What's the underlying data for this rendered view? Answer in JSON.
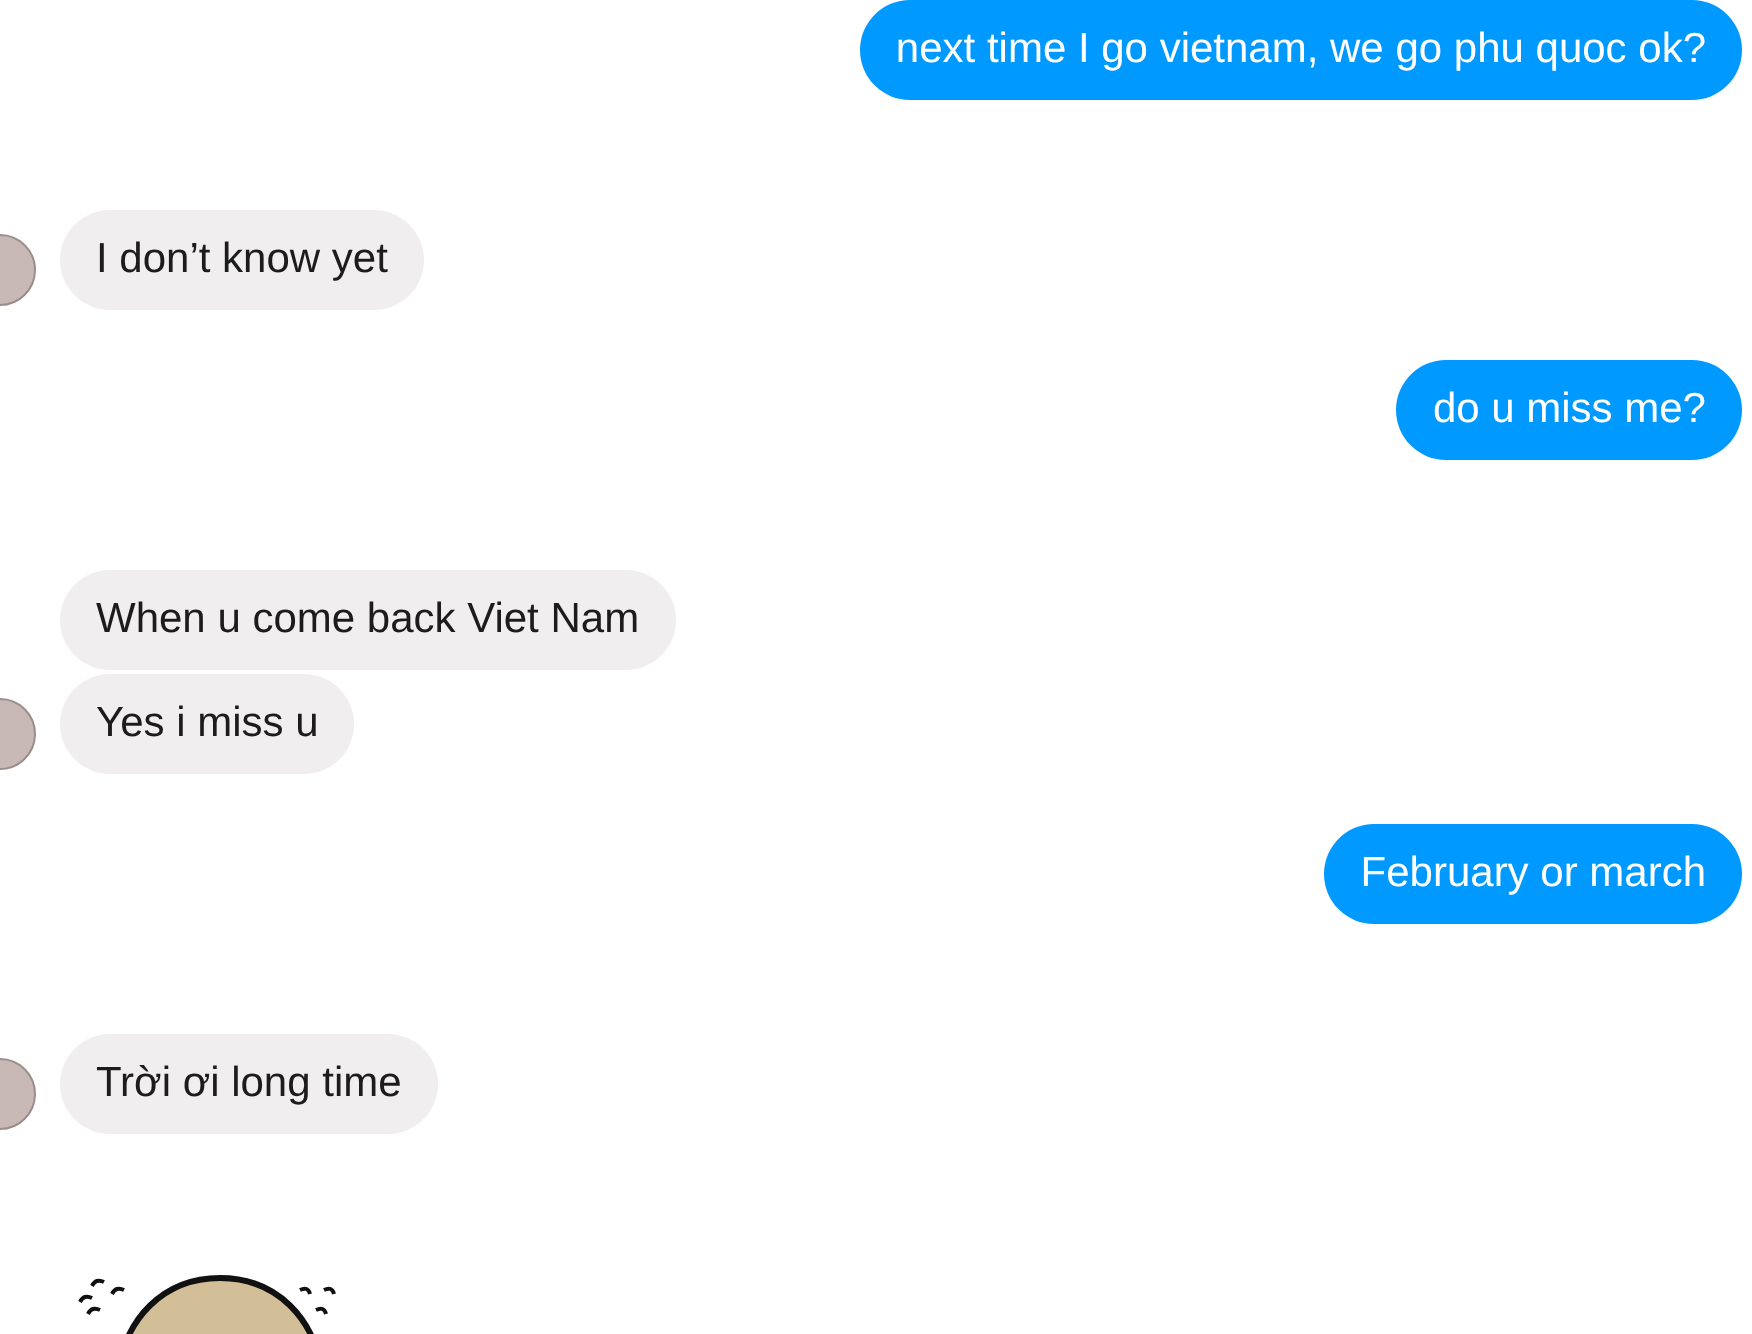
{
  "groups": [
    {
      "kind": "sent",
      "messages": [
        {
          "kind": "text",
          "text": "next time I go vietnam, we go phu quoc ok?"
        }
      ]
    },
    {
      "kind": "received",
      "messages": [
        {
          "kind": "text",
          "text": "I don’t know yet"
        }
      ]
    },
    {
      "kind": "sent",
      "messages": [
        {
          "kind": "text",
          "text": "do u miss me?"
        }
      ]
    },
    {
      "kind": "received",
      "messages": [
        {
          "kind": "text",
          "text": "When u come back Viet Nam"
        },
        {
          "kind": "text",
          "text": "Yes i miss u"
        }
      ]
    },
    {
      "kind": "sent",
      "messages": [
        {
          "kind": "text",
          "text": "February or march"
        }
      ]
    },
    {
      "kind": "received",
      "messages": [
        {
          "kind": "text",
          "text": "Trời ơi long time"
        }
      ]
    },
    {
      "kind": "received",
      "messages": [
        {
          "kind": "sticker"
        }
      ]
    }
  ]
}
